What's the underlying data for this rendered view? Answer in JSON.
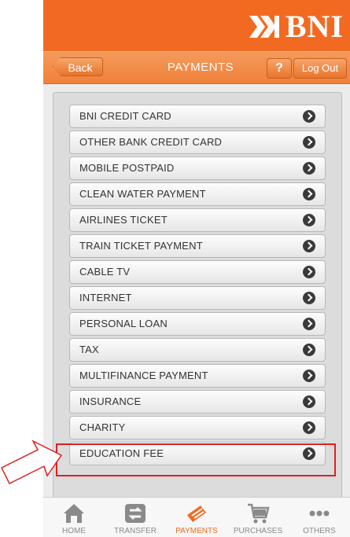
{
  "brand": {
    "logo_text": "BNI",
    "logo_icon": "bni-46-emblem-icon",
    "color": "#f26a21"
  },
  "navbar": {
    "back_label": "Back",
    "title": "PAYMENTS",
    "help_label": "?",
    "logout_label": "Log Out"
  },
  "menu": {
    "items": [
      {
        "label": "BNI CREDIT CARD"
      },
      {
        "label": "OTHER BANK CREDIT CARD"
      },
      {
        "label": "MOBILE POSTPAID"
      },
      {
        "label": "CLEAN WATER PAYMENT"
      },
      {
        "label": "AIRLINES TICKET"
      },
      {
        "label": "TRAIN TICKET PAYMENT"
      },
      {
        "label": "CABLE TV"
      },
      {
        "label": "INTERNET"
      },
      {
        "label": "PERSONAL LOAN"
      },
      {
        "label": "TAX"
      },
      {
        "label": "MULTIFINANCE PAYMENT"
      },
      {
        "label": "INSURANCE"
      },
      {
        "label": "CHARITY"
      },
      {
        "label": "EDUCATION FEE"
      }
    ],
    "highlighted_item": "EDUCATION FEE",
    "highlight_color": "#e02020"
  },
  "tabbar": {
    "tabs": [
      {
        "label": "HOME",
        "icon": "home-icon"
      },
      {
        "label": "TRANSFER",
        "icon": "transfer-icon"
      },
      {
        "label": "PAYMENTS",
        "icon": "payments-icon",
        "active": true
      },
      {
        "label": "PURCHASES",
        "icon": "cart-icon"
      },
      {
        "label": "OTHERS",
        "icon": "more-icon"
      }
    ],
    "active_color": "#f26a21"
  }
}
